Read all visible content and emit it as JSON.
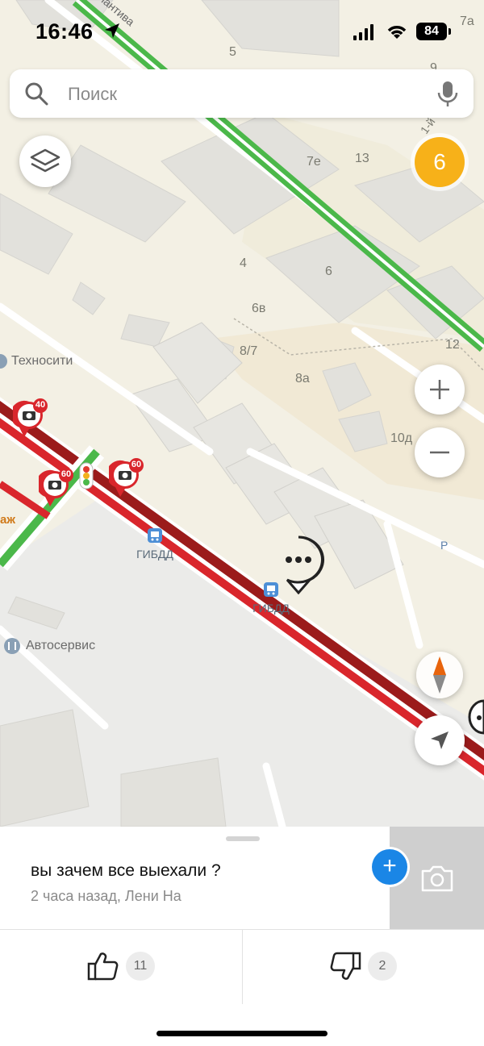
{
  "status_bar": {
    "time": "16:46",
    "battery": "84"
  },
  "search": {
    "placeholder": "Поиск"
  },
  "map": {
    "notification_count": "6",
    "house_numbers": [
      "5",
      "7а",
      "7е",
      "13",
      "4",
      "6",
      "6в",
      "8/7",
      "8а",
      "12",
      "10д",
      "9"
    ],
    "street_fragments": [
      "1-й",
      "ев",
      "лантива"
    ],
    "pois": [
      {
        "label": "Техносити",
        "icon": "store-icon"
      },
      {
        "label": "Автосервис",
        "icon": "wrench-icon"
      },
      {
        "label": "ГИБДД",
        "icon": "bus-stop-icon"
      },
      {
        "label": "ГИБДД",
        "icon": "bus-stop-icon"
      },
      {
        "label": "Р",
        "icon": "parking-icon"
      },
      {
        "label": "аж",
        "icon": ""
      }
    ],
    "speed_cameras": [
      {
        "limit": "40"
      },
      {
        "limit": "60"
      },
      {
        "limit": "60"
      }
    ],
    "traffic_colors": {
      "jam": "#9b1b1b",
      "slow": "#d9262c",
      "free": "#4bb84a"
    }
  },
  "sheet": {
    "comment": "вы зачем все выехали ?",
    "meta": "2 часа назад, Лени На",
    "likes": "11",
    "dislikes": "2"
  }
}
